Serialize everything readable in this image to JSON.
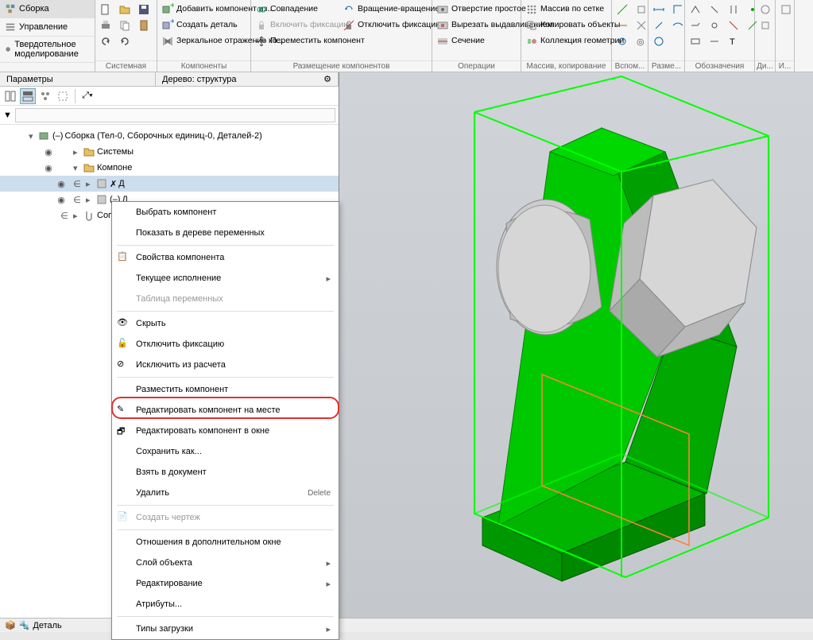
{
  "sidebar_tabs": {
    "assembly": "Сборка",
    "management": "Управление",
    "solid_modeling": "Твердотельное моделирование"
  },
  "ribbon": {
    "system": "Системная",
    "components": "Компоненты",
    "placement": "Размещение компонентов",
    "operations": "Операции",
    "array": "Массив, копирование",
    "auxiliary": "Вспом...",
    "dimensions": "Разме...",
    "annotations": "Обозначения",
    "diag": "Ди...",
    "add_component": "Добавить компонент из...",
    "create_part": "Создать деталь",
    "mirror": "Зеркальное отражение ко...",
    "match": "Совпадение",
    "enable_fix": "Включить фиксацию",
    "move_comp": "Переместить компонент",
    "rotate": "Вращение-вращение",
    "disable_fix": "Отключить фиксацию",
    "hole": "Отверстие простое",
    "cut_extrude": "Вырезать выдавливанием",
    "section": "Сечение",
    "grid_array": "Массив по сетке",
    "copy_objects": "Копировать объекты",
    "geometry_collection": "Коллекция геометрии",
    "ins": "И..."
  },
  "panes": {
    "parameters": "Параметры",
    "tree_structure": "Дерево: структура"
  },
  "search_placeholder": "",
  "tree": {
    "root": "Сборка (Тел-0, Сборочных единиц-0, Деталей-2)",
    "systems": "Системы",
    "components": "Компоне",
    "part1": "Д",
    "part2": "Д",
    "mates": "Сопря"
  },
  "context_menu": {
    "select_component": "Выбрать компонент",
    "show_in_var_tree": "Показать в дереве переменных",
    "component_props": "Свойства компонента",
    "current_exec": "Текущее исполнение",
    "var_table": "Таблица переменных",
    "hide": "Скрыть",
    "disable_fix": "Отключить фиксацию",
    "exclude_calc": "Исключить из расчета",
    "place_component": "Разместить компонент",
    "edit_in_place": "Редактировать компонент на месте",
    "edit_in_window": "Редактировать компонент в окне",
    "save_as": "Сохранить как...",
    "take_to_doc": "Взять в документ",
    "delete": "Удалить",
    "delete_shortcut": "Delete",
    "create_drawing": "Создать чертеж",
    "relations_window": "Отношения в дополнительном окне",
    "object_layer": "Слой объекта",
    "editing": "Редактирование",
    "attributes": "Атрибуты...",
    "load_types": "Типы загрузки"
  },
  "bottom": {
    "part_tab": "Деталь"
  }
}
